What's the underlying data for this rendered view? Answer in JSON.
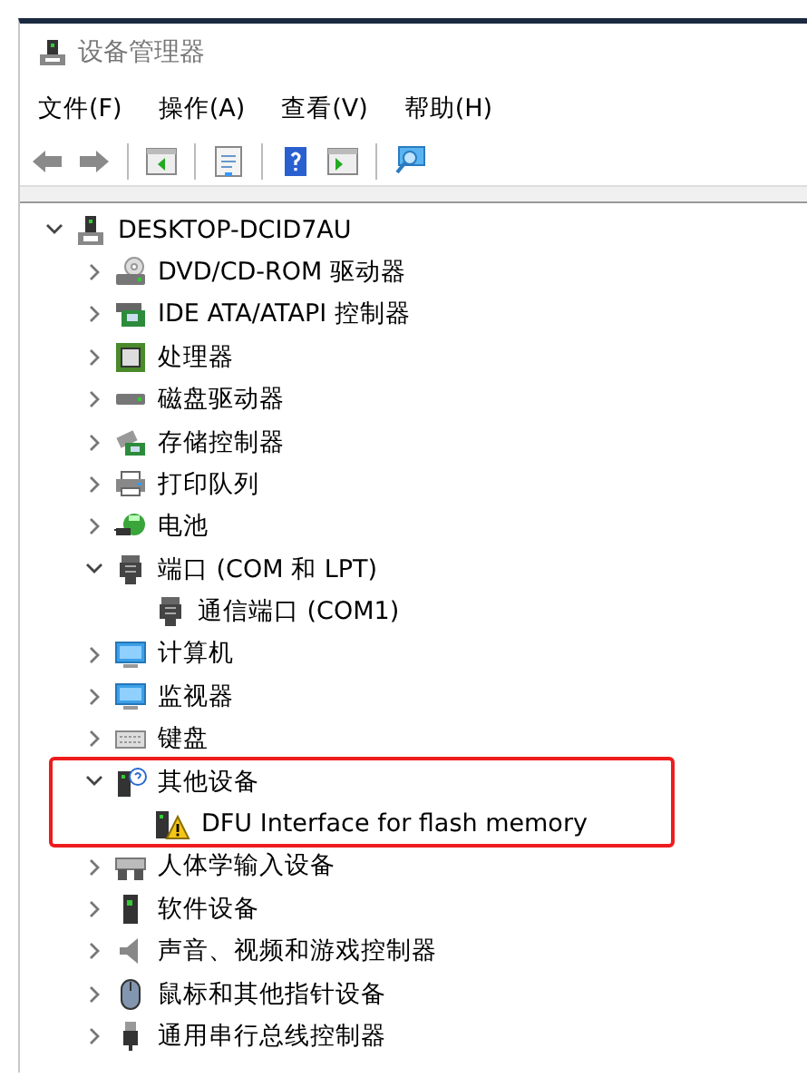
{
  "window": {
    "title": "设备管理器"
  },
  "menu": [
    "文件(F)",
    "操作(A)",
    "查看(V)",
    "帮助(H)"
  ],
  "toolbar": [
    {
      "kind": "back",
      "disabled": false
    },
    {
      "kind": "forward",
      "disabled": false
    },
    {
      "kind": "sep"
    },
    {
      "kind": "tree",
      "disabled": false
    },
    {
      "kind": "sep"
    },
    {
      "kind": "props",
      "disabled": false
    },
    {
      "kind": "sep"
    },
    {
      "kind": "help",
      "disabled": false
    },
    {
      "kind": "pane",
      "disabled": false
    },
    {
      "kind": "sep"
    },
    {
      "kind": "scan",
      "disabled": false
    }
  ],
  "tree": [
    {
      "label": "DESKTOP-DCID7AU",
      "kind": "computer",
      "expanded": true,
      "children": [
        {
          "label": "DVD/CD-ROM 驱动器",
          "kind": "dvd",
          "expanded": false
        },
        {
          "label": "IDE ATA/ATAPI 控制器",
          "kind": "ide",
          "expanded": false
        },
        {
          "label": "处理器",
          "kind": "cpu",
          "expanded": false
        },
        {
          "label": "磁盘驱动器",
          "kind": "disk",
          "expanded": false
        },
        {
          "label": "存储控制器",
          "kind": "storage",
          "expanded": false
        },
        {
          "label": "打印队列",
          "kind": "printer",
          "expanded": false
        },
        {
          "label": "电池",
          "kind": "battery",
          "expanded": false
        },
        {
          "label": "端口 (COM 和 LPT)",
          "kind": "port",
          "expanded": true,
          "children": [
            {
              "label": "通信端口 (COM1)",
              "kind": "port"
            }
          ]
        },
        {
          "label": "计算机",
          "kind": "monitor",
          "expanded": false
        },
        {
          "label": "监视器",
          "kind": "monitor",
          "expanded": false
        },
        {
          "label": "键盘",
          "kind": "keyboard",
          "expanded": false
        },
        {
          "label": "其他设备",
          "kind": "unknown",
          "expanded": true,
          "highlighted": true,
          "children": [
            {
              "label": "DFU Interface for flash memory",
              "kind": "warning"
            }
          ]
        },
        {
          "label": "人体学输入设备",
          "kind": "hid",
          "expanded": false
        },
        {
          "label": "软件设备",
          "kind": "software",
          "expanded": false
        },
        {
          "label": "声音、视频和游戏控制器",
          "kind": "sound",
          "expanded": false
        },
        {
          "label": "鼠标和其他指针设备",
          "kind": "mouse",
          "expanded": false
        },
        {
          "label": "通用串行总线控制器",
          "kind": "usb",
          "expanded": false
        }
      ]
    }
  ]
}
